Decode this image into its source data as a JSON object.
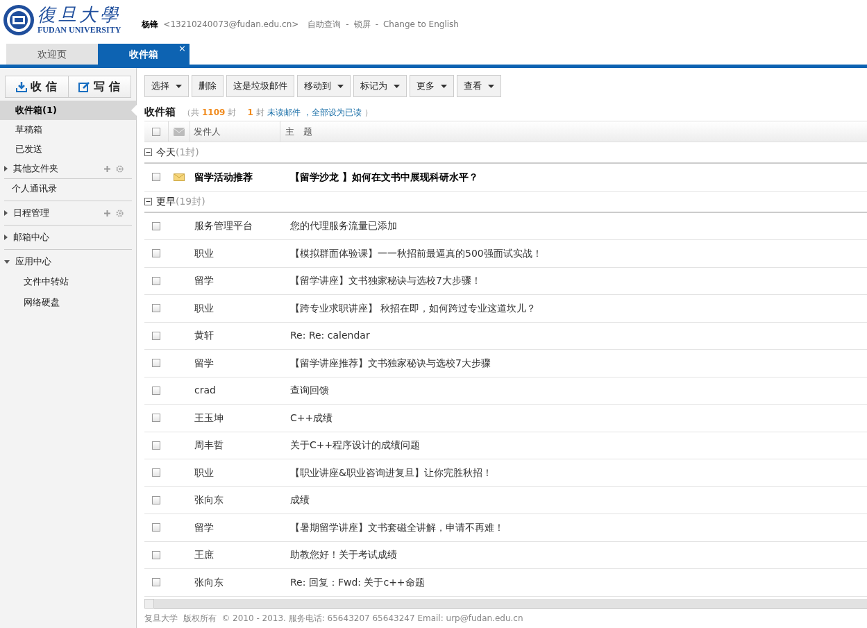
{
  "logo": {
    "title": "復旦大學",
    "subtitle": "FUDAN UNIVERSITY"
  },
  "user": {
    "name": "杨锋",
    "email": "<13210240073@fudan.edu.cn>",
    "links": [
      "自助查询",
      "锁屏",
      "Change to English"
    ],
    "separator": "-"
  },
  "tabs": [
    {
      "label": "欢迎页",
      "selected": false
    },
    {
      "label": "收件箱",
      "selected": true,
      "close": "×"
    }
  ],
  "compose_buttons": [
    {
      "label": "收 信",
      "kind": "receive"
    },
    {
      "label": "写 信",
      "kind": "write"
    }
  ],
  "sidebar": {
    "items": [
      {
        "label": "收件箱(1)",
        "kind": "folder",
        "selected": true
      },
      {
        "label": "草稿箱",
        "kind": "folder",
        "selected": false
      },
      {
        "label": "已发送",
        "kind": "folder",
        "selected": false
      },
      {
        "label": "其他文件夹",
        "kind": "section",
        "expanded": false,
        "tools": true
      },
      {
        "label": "个人通讯录",
        "kind": "link"
      },
      {
        "label": "日程管理",
        "kind": "section",
        "expanded": false,
        "tools": true
      },
      {
        "label": "邮箱中心",
        "kind": "section",
        "expanded": false,
        "tools": false
      },
      {
        "label": "应用中心",
        "kind": "section",
        "expanded": true,
        "tools": false,
        "children": [
          {
            "label": "文件中转站"
          },
          {
            "label": "网络硬盘"
          }
        ]
      }
    ]
  },
  "toolbar": [
    {
      "label": "选择",
      "dropdown": true
    },
    {
      "label": "删除",
      "dropdown": false
    },
    {
      "label": "这是垃圾邮件",
      "dropdown": false
    },
    {
      "label": "移动到",
      "dropdown": true
    },
    {
      "label": "标记为",
      "dropdown": true
    },
    {
      "label": "更多",
      "dropdown": true
    },
    {
      "label": "查看",
      "dropdown": true
    }
  ],
  "summary": {
    "title": "收件箱",
    "total_prefix": "（共",
    "total": "1109",
    "total_suffix": "封",
    "unread_count": "1",
    "unread_unit": "封",
    "unread_link": "未读邮件",
    "mark_all_link": "，全部设为已读",
    "close_paren": "）"
  },
  "table": {
    "select_all": {
      "checked": false
    },
    "columns": [
      "发件人",
      "主　题"
    ],
    "groups": [
      {
        "label": "今天",
        "count": "(1封)",
        "expanded": true,
        "emails": [
          {
            "sender": "留学活动推荐",
            "subject": "【留学沙龙 】如何在文书中展现科研水平？",
            "unread": true,
            "checked": false
          }
        ]
      },
      {
        "label": "更早",
        "count": "(19封)",
        "expanded": true,
        "emails": [
          {
            "sender": "服务管理平台",
            "subject": "您的代理服务流量已添加",
            "unread": false,
            "checked": false
          },
          {
            "sender": "职业",
            "subject": "【模拟群面体验课】一一秋招前最逼真的500强面试实战！",
            "unread": false,
            "checked": false
          },
          {
            "sender": "留学",
            "subject": "【留学讲座】文书独家秘诀与选校7大步骤！",
            "unread": false,
            "checked": false
          },
          {
            "sender": "职业",
            "subject": "【跨专业求职讲座】 秋招在即，如何跨过专业这道坎儿？",
            "unread": false,
            "checked": false
          },
          {
            "sender": "黄轩",
            "subject": "Re: Re: calendar",
            "unread": false,
            "checked": false
          },
          {
            "sender": "留学",
            "subject": "【留学讲座推荐】文书独家秘诀与选校7大步骤",
            "unread": false,
            "checked": false
          },
          {
            "sender": "crad",
            "subject": "查询回馈",
            "unread": false,
            "checked": false
          },
          {
            "sender": "王玉坤",
            "subject": "C++成绩",
            "unread": false,
            "checked": false
          },
          {
            "sender": "周丰哲",
            "subject": "关于C++程序设计的成绩问题",
            "unread": false,
            "checked": false
          },
          {
            "sender": "职业",
            "subject": "【职业讲座&职业咨询进复旦】让你完胜秋招！",
            "unread": false,
            "checked": false
          },
          {
            "sender": "张向东",
            "subject": "成绩",
            "unread": false,
            "checked": false
          },
          {
            "sender": "留学",
            "subject": "【暑期留学讲座】文书套磁全讲解，申请不再难！",
            "unread": false,
            "checked": false
          },
          {
            "sender": "王庶",
            "subject": "助教您好！关于考试成绩",
            "unread": false,
            "checked": false
          },
          {
            "sender": "张向东",
            "subject": "Re: 回复：Fwd: 关于c++命题",
            "unread": false,
            "checked": false
          }
        ]
      }
    ]
  },
  "footer": "复旦大学  版权所有  © 2010 - 2013. 服务电话: 65643207 65643247 Email: urp@fudan.edu.cn"
}
